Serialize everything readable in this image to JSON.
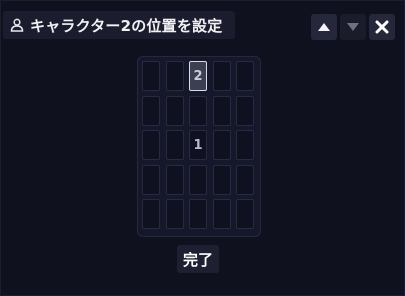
{
  "dialog": {
    "title": "キャラクター2の位置を設定",
    "icons": {
      "title": "user-icon",
      "move_up": "triangle-up-icon",
      "move_down": "triangle-down-icon",
      "close": "close-icon"
    }
  },
  "grid": {
    "rows": 5,
    "cols": 5,
    "cells": [
      [
        "",
        "",
        "2",
        "",
        ""
      ],
      [
        "",
        "",
        "",
        "",
        ""
      ],
      [
        "",
        "",
        "1",
        "",
        ""
      ],
      [
        "",
        "",
        "",
        "",
        ""
      ],
      [
        "",
        "",
        "",
        "",
        ""
      ]
    ],
    "selected": {
      "row": 0,
      "col": 2
    }
  },
  "footer": {
    "done_label": "完了"
  },
  "colors": {
    "background": "#10111f",
    "cell_selected_border": "#d8dae6"
  }
}
